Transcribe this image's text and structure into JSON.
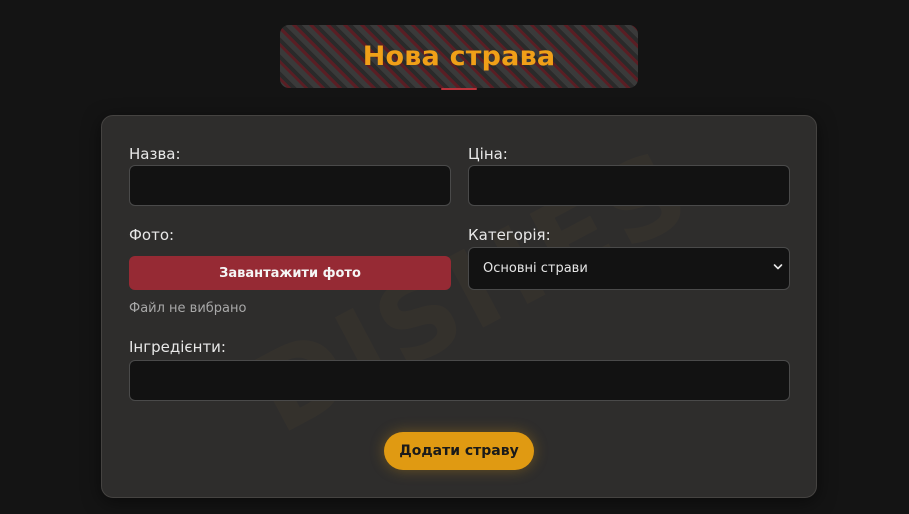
{
  "header": {
    "title": "Нова страва"
  },
  "form": {
    "watermark": "DISHES",
    "name": {
      "label": "Назва:",
      "value": ""
    },
    "price": {
      "label": "Ціна:",
      "value": ""
    },
    "photo": {
      "label": "Фото:",
      "button_label": "Завантажити фото",
      "status": "Файл не вибрано"
    },
    "category": {
      "label": "Категорія:",
      "selected": "Основні страви"
    },
    "ingredients": {
      "label": "Інгредієнти:",
      "value": ""
    },
    "submit_label": "Додати страву"
  },
  "colors": {
    "background": "#141414",
    "card": "#2e2d2c",
    "accent_orange": "#e09a12",
    "title_orange": "#f0a018",
    "upload_red": "#962a34"
  }
}
